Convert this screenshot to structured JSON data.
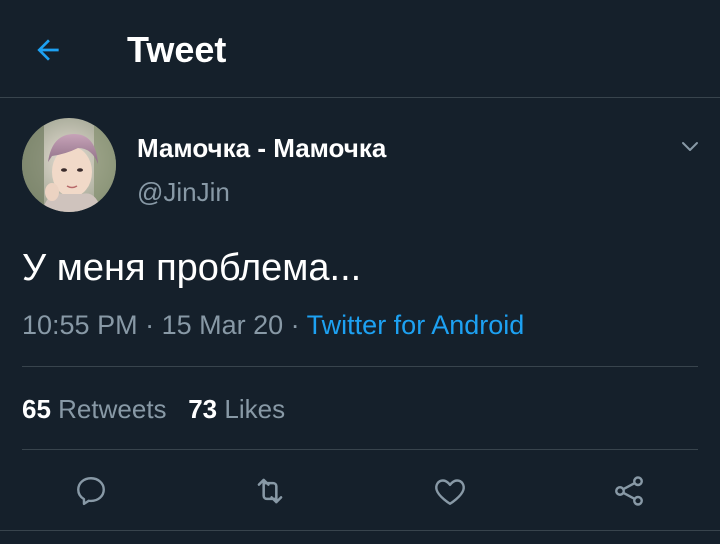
{
  "header": {
    "title": "Tweet",
    "back_icon": "arrow-left-icon"
  },
  "tweet": {
    "author": {
      "display_name": "Мамочка - Мамочка",
      "handle": "@JinJin"
    },
    "text": "У меня проблема...",
    "time": "10:55 PM",
    "date": "15 Mar 20",
    "separator": " · ",
    "source": "Twitter for Android",
    "retweets_count": "65",
    "retweets_label": "Retweets",
    "likes_count": "73",
    "likes_label": "Likes"
  },
  "actions": [
    {
      "name": "reply",
      "icon": "reply-icon"
    },
    {
      "name": "retweet",
      "icon": "retweet-icon"
    },
    {
      "name": "like",
      "icon": "heart-icon"
    },
    {
      "name": "share",
      "icon": "share-icon"
    }
  ],
  "colors": {
    "background": "#15202b",
    "accent": "#1da1f2",
    "secondary_text": "#8899a6",
    "divider": "#38444d"
  }
}
